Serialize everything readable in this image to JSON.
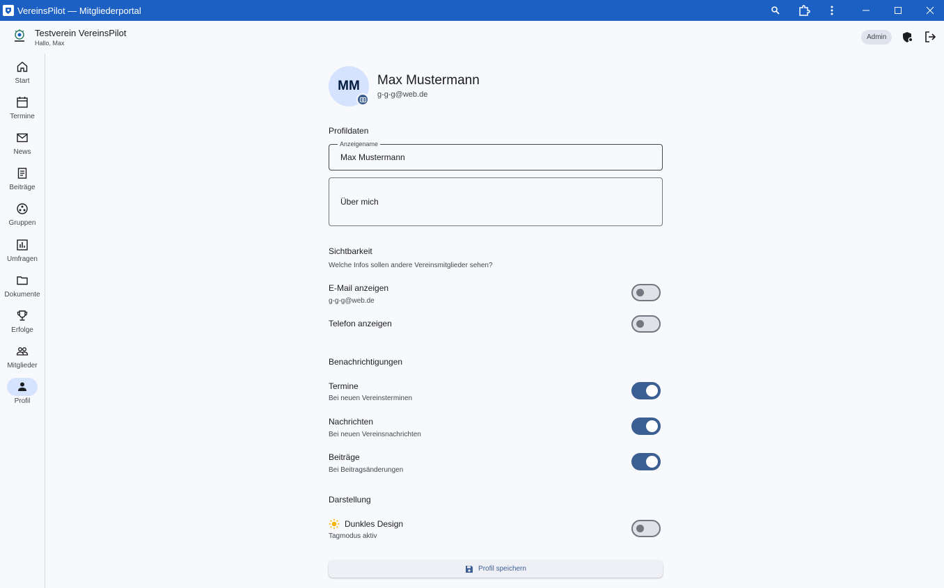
{
  "window": {
    "title": "VereinsPilot — Mitgliederportal"
  },
  "header": {
    "club_name": "Testverein VereinsPilot",
    "greeting": "Hallo, Max",
    "role_badge": "Admin"
  },
  "nav": {
    "items": [
      {
        "label": "Start",
        "icon": "home-icon",
        "active": false
      },
      {
        "label": "Termine",
        "icon": "calendar-icon",
        "active": false
      },
      {
        "label": "News",
        "icon": "mail-icon",
        "active": false
      },
      {
        "label": "Beiträge",
        "icon": "receipt-icon",
        "active": false
      },
      {
        "label": "Gruppen",
        "icon": "groups-icon",
        "active": false
      },
      {
        "label": "Umfragen",
        "icon": "poll-icon",
        "active": false
      },
      {
        "label": "Dokumente",
        "icon": "folder-icon",
        "active": false
      },
      {
        "label": "Erfolge",
        "icon": "trophy-icon",
        "active": false
      },
      {
        "label": "Mitglieder",
        "icon": "people-icon",
        "active": false
      },
      {
        "label": "Profil",
        "icon": "person-icon",
        "active": true
      }
    ]
  },
  "profile": {
    "initials": "MM",
    "name": "Max Mustermann",
    "email": "g-g-g@web.de"
  },
  "profile_data": {
    "section_title": "Profildaten",
    "display_name_label": "Anzeigename",
    "display_name_value": "Max Mustermann",
    "about_placeholder": "Über mich"
  },
  "visibility": {
    "section_title": "Sichtbarkeit",
    "section_subtitle": "Welche Infos sollen andere Vereinsmitglieder sehen?",
    "show_email": {
      "title": "E-Mail anzeigen",
      "subtitle": "g-g-g@web.de",
      "enabled": false
    },
    "show_phone": {
      "title": "Telefon anzeigen",
      "enabled": false
    }
  },
  "notifications": {
    "section_title": "Benachrichtigungen",
    "events": {
      "title": "Termine",
      "subtitle": "Bei neuen Vereinsterminen",
      "enabled": true
    },
    "news": {
      "title": "Nachrichten",
      "subtitle": "Bei neuen Vereinsnachrichten",
      "enabled": true
    },
    "fees": {
      "title": "Beiträge",
      "subtitle": "Bei Beitragsänderungen",
      "enabled": true
    }
  },
  "appearance": {
    "section_title": "Darstellung",
    "dark_mode": {
      "title": "Dunkles Design",
      "subtitle": "Tagmodus aktiv",
      "enabled": false,
      "icon": "sun-icon"
    }
  },
  "actions": {
    "save_label": "Profil speichern"
  },
  "colors": {
    "titlebar": "#1b60c2",
    "primary": "#3b5e93",
    "nav_active": "#d6e3ff",
    "sun": "#f5b400"
  }
}
